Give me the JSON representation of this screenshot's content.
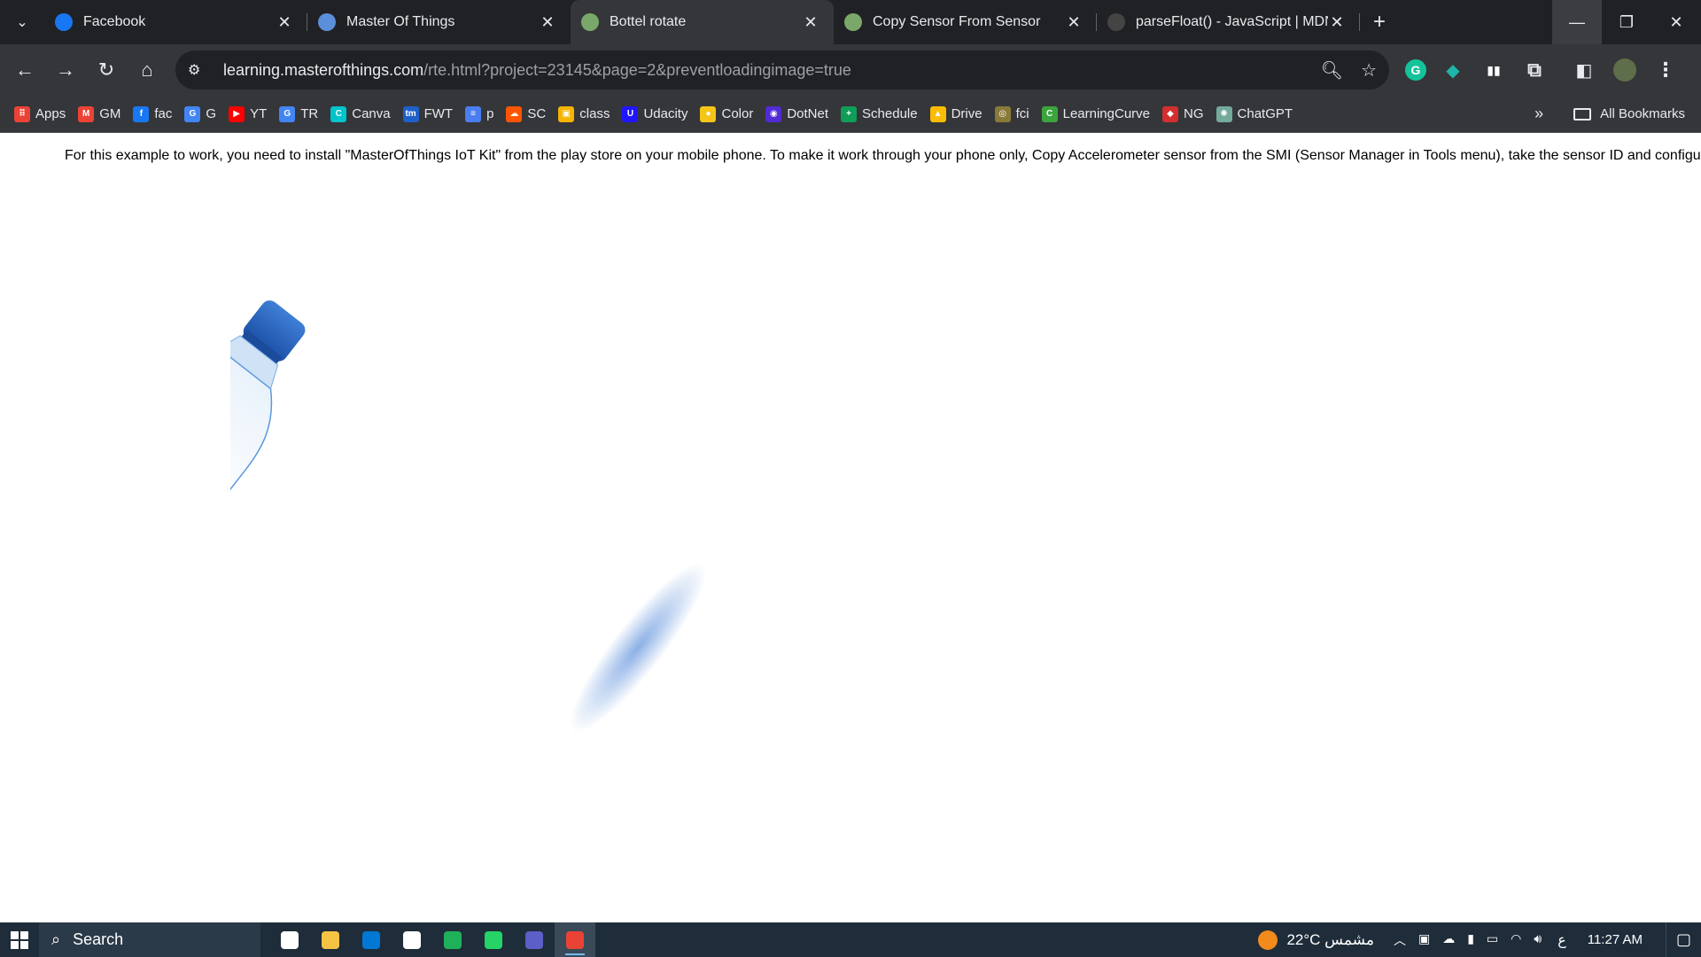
{
  "colors": {
    "tab_strip_bg": "#202124",
    "toolbar_bg": "#35363a",
    "page_bg": "#ffffff",
    "taskbar_bg": "#1f2d3a",
    "bottle_blue": "#2a6bd1"
  },
  "tabs": [
    {
      "title": "Facebook",
      "icon": "facebook-icon",
      "color": "#1877f2",
      "active": false
    },
    {
      "title": "Master Of Things",
      "icon": "masterofthings-icon",
      "color": "#5b8fd9",
      "active": false
    },
    {
      "title": "Bottel rotate",
      "icon": "masterofthings-icon",
      "color": "#7aa86a",
      "active": true
    },
    {
      "title": "Copy Sensor From Sensor",
      "icon": "masterofthings-icon",
      "color": "#7aa86a",
      "active": false
    },
    {
      "title": "parseFloat() - JavaScript | MDN",
      "icon": "mdn-icon",
      "color": "#444444",
      "active": false
    }
  ],
  "address_bar": {
    "host": "learning.masterofthings.com",
    "path": "/rte.html?project=23145&page=2&preventloadingimage=true"
  },
  "bookmarks": [
    {
      "label": "Apps",
      "icon": "apps-grid-icon",
      "color": "#ea4335",
      "glyph": "⠿"
    },
    {
      "label": "GM",
      "icon": "gmail-icon",
      "color": "#ea4335",
      "glyph": "M"
    },
    {
      "label": "fac",
      "icon": "facebook-icon",
      "color": "#1877f2",
      "glyph": "f"
    },
    {
      "label": "G",
      "icon": "google-icon",
      "color": "#4285f4",
      "glyph": "G"
    },
    {
      "label": "YT",
      "icon": "youtube-icon",
      "color": "#ff0000",
      "glyph": "▶"
    },
    {
      "label": "TR",
      "icon": "translate-icon",
      "color": "#4285f4",
      "glyph": "G"
    },
    {
      "label": "Canva",
      "icon": "canva-icon",
      "color": "#00c4cc",
      "glyph": "C"
    },
    {
      "label": "FWT",
      "icon": "fwt-icon",
      "color": "#1e60c8",
      "glyph": "tm"
    },
    {
      "label": "p",
      "icon": "forms-icon",
      "color": "#4a7ef0",
      "glyph": "≡"
    },
    {
      "label": "SC",
      "icon": "soundcloud-icon",
      "color": "#ff5500",
      "glyph": "☁"
    },
    {
      "label": "class",
      "icon": "classroom-icon",
      "color": "#f4b400",
      "glyph": "▣"
    },
    {
      "label": "Udacity",
      "icon": "udacity-icon",
      "color": "#2015ff",
      "glyph": "U"
    },
    {
      "label": "Color",
      "icon": "color-icon",
      "color": "#f5c518",
      "glyph": "●"
    },
    {
      "label": "DotNet",
      "icon": "dotnet-icon",
      "color": "#512bd4",
      "glyph": "◉"
    },
    {
      "label": "Schedule",
      "icon": "sheets-icon",
      "color": "#0f9d58",
      "glyph": "+"
    },
    {
      "label": "Drive",
      "icon": "drive-icon",
      "color": "#fbbc04",
      "glyph": "▲"
    },
    {
      "label": "fci",
      "icon": "fci-icon",
      "color": "#8a7a3a",
      "glyph": "◎"
    },
    {
      "label": "LearningCurve",
      "icon": "learningcurve-icon",
      "color": "#3ca43c",
      "glyph": "C"
    },
    {
      "label": "NG",
      "icon": "shield-icon",
      "color": "#d32f2f",
      "glyph": "◆"
    },
    {
      "label": "ChatGPT",
      "icon": "chatgpt-icon",
      "color": "#74aa9c",
      "glyph": "✺"
    }
  ],
  "bookmarks_overflow": "»",
  "all_bookmarks_label": "All Bookmarks",
  "page": {
    "instruction": "For this example to work, you need to install \"MasterOfThings IoT Kit\" from the play store on your mobile phone. To make it work through your phone only, Copy Accelerometer sensor from the SMI (Sensor Manager in Tools menu), take the sensor ID and configure it"
  },
  "taskbar": {
    "search_label": "Search",
    "apps": [
      {
        "name": "taskview-icon",
        "color": "#ffffff",
        "running": false
      },
      {
        "name": "file-explorer-icon",
        "color": "#f6c343",
        "running": false
      },
      {
        "name": "microsoft-store-icon",
        "color": "#0078d4",
        "running": false
      },
      {
        "name": "mail-icon",
        "color": "#ffffff",
        "running": false
      },
      {
        "name": "edge-icon",
        "color": "#1fb15a",
        "running": false
      },
      {
        "name": "whatsapp-icon",
        "color": "#25d366",
        "running": false
      },
      {
        "name": "teams-icon",
        "color": "#5b5fc7",
        "running": false
      },
      {
        "name": "chrome-icon",
        "color": "#ea4335",
        "running": true
      }
    ],
    "weather_temp": "22°C",
    "weather_text": "مشمس",
    "language": "ع",
    "time": "11:27 AM"
  }
}
